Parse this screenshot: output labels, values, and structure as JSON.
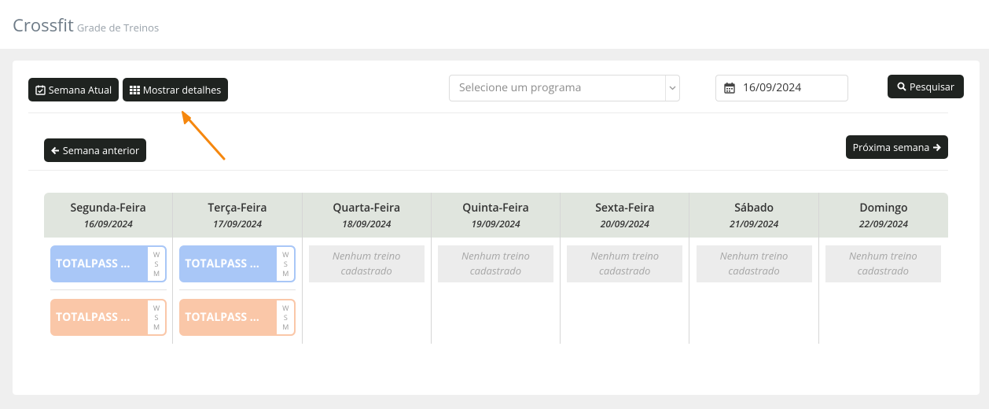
{
  "header": {
    "title": "Crossfit",
    "subtitle": "Grade de Treinos"
  },
  "toolbar": {
    "week_current_label": "Semana Atual",
    "show_details_label": "Mostrar detalhes",
    "program_select_placeholder": "Selecione um programa",
    "date_value": "16/09/2024",
    "search_label": "Pesquisar"
  },
  "nav": {
    "prev_label": "Semana anterior",
    "next_label": "Próxima semana"
  },
  "colors": {
    "button": "#1f2320",
    "header_bg": "#e0e5de",
    "card_blue": "#a9c7f7",
    "card_orange": "#fac7a8",
    "annotation_arrow": "#f5870e"
  },
  "days": [
    {
      "name": "Segunda-Feira",
      "date": "16/09/2024",
      "workouts": [
        {
          "label": "TOTALPASS ...",
          "tags": [
            "W",
            "S",
            "M"
          ],
          "color": "blue"
        },
        {
          "label": "TOTALPASS ...",
          "tags": [
            "W",
            "S",
            "M"
          ],
          "color": "orange"
        }
      ]
    },
    {
      "name": "Terça-Feira",
      "date": "17/09/2024",
      "workouts": [
        {
          "label": "TOTALPASS ...",
          "tags": [
            "W",
            "S",
            "M"
          ],
          "color": "blue"
        },
        {
          "label": "TOTALPASS ...",
          "tags": [
            "W",
            "S",
            "M"
          ],
          "color": "orange"
        }
      ]
    },
    {
      "name": "Quarta-Feira",
      "date": "18/09/2024",
      "empty_text": "Nenhum treino cadastrado"
    },
    {
      "name": "Quinta-Feira",
      "date": "19/09/2024",
      "empty_text": "Nenhum treino cadastrado"
    },
    {
      "name": "Sexta-Feira",
      "date": "20/09/2024",
      "empty_text": "Nenhum treino cadastrado"
    },
    {
      "name": "Sábado",
      "date": "21/09/2024",
      "empty_text": "Nenhum treino cadastrado"
    },
    {
      "name": "Domingo",
      "date": "22/09/2024",
      "empty_text": "Nenhum treino cadastrado"
    }
  ]
}
